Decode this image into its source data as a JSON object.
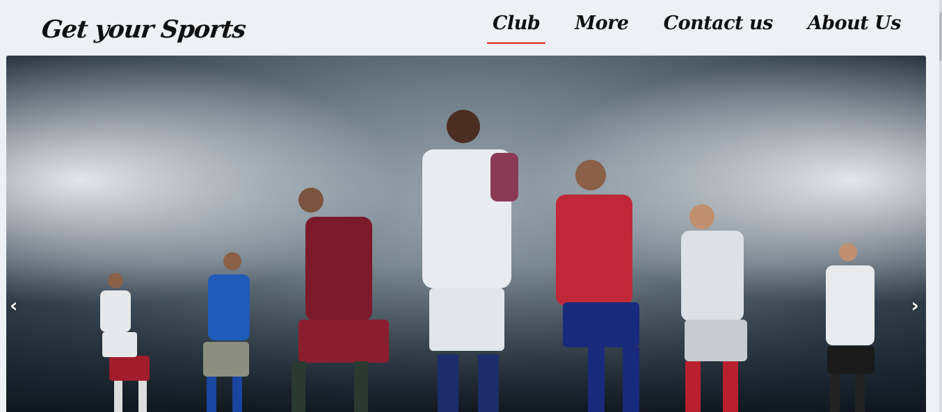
{
  "header": {
    "brand": "Get your Sports"
  },
  "nav": {
    "items": [
      {
        "label": "Club",
        "active": true
      },
      {
        "label": "More",
        "active": false
      },
      {
        "label": "Contact us",
        "active": false
      },
      {
        "label": "About Us",
        "active": false
      }
    ]
  },
  "carousel": {
    "prev_label": "‹",
    "next_label": "›",
    "image_alt": "Football players running in a stadium"
  },
  "colors": {
    "background": "#edf1f3",
    "active_underline": "#e02020",
    "text": "#111111"
  }
}
